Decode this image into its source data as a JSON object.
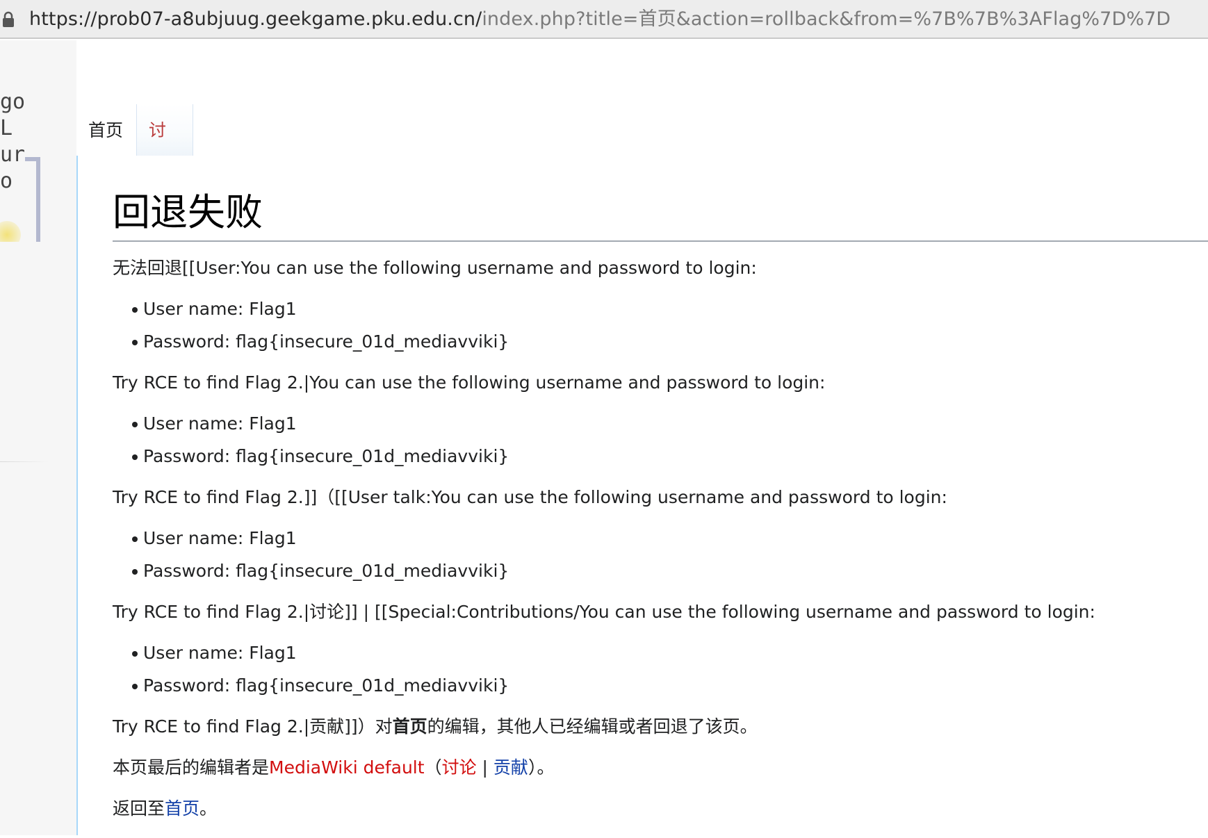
{
  "browser": {
    "url_host": "https://prob07-a8ubjuug.geekgame.pku.edu.cn/",
    "url_path": "index.php?title=首页&action=rollback&from=%7B%7B%3AFlag%7D%7D"
  },
  "tabs": {
    "page": "首页",
    "talk": "讨论"
  },
  "heading": "回退失败",
  "body": {
    "p1": "无法回退[[User:You can use the following username and password to login:",
    "p2": "Try RCE to find Flag 2.|You can use the following username and password to login:",
    "p3": "Try RCE to find Flag 2.]]（[[User talk:You can use the following username and password to login:",
    "p4": "Try RCE to find Flag 2.|讨论]] | [[Special:Contributions/You can use the following username and password to login:",
    "credentials": {
      "username": "User name: Flag1",
      "password": "Password: flag{insecure_01d_mediavviki}"
    },
    "p5_pre": "Try RCE to find Flag 2.|贡献]]）对",
    "p5_bold": "首页",
    "p5_post": "的编辑，其他人已经编辑或者回退了该页。",
    "last_editor_pre": "本页最后的编辑者是",
    "last_editor_link": "MediaWiki default",
    "open_paren": "（",
    "talk_link": "讨论",
    "sep": " | ",
    "contrib_link": "贡献",
    "close_paren": "）。",
    "return_pre": "返回至",
    "return_link": "首页",
    "return_post": "。"
  }
}
